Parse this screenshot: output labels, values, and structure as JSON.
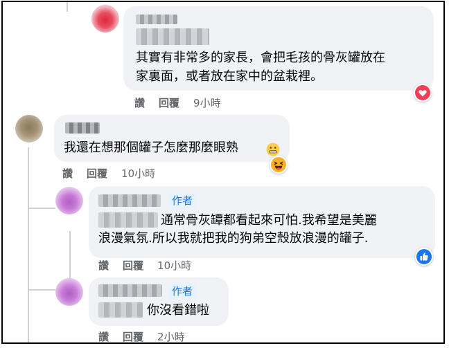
{
  "comments": [
    {
      "body_lines": [
        "其實有非常多的家長，會把毛孩的骨灰罐放在",
        "家裏面，或者放在家中的盆栽裡。"
      ],
      "actions": {
        "like": "讚",
        "reply": "回覆",
        "time": "9小時"
      },
      "reaction": "love-icon"
    },
    {
      "body_lines": [
        "我還在想那個罐子怎麼那麼眼熟"
      ],
      "emoji": "grimace-emoji",
      "actions": {
        "like": "讚",
        "reply": "回覆",
        "time": "10小時"
      },
      "reaction": "laugh-icon"
    },
    {
      "badge": "作者",
      "body_lines": [
        "通常骨灰罈都看起來可怕.我￼希望是美麗",
        "浪漫氣氛.所以我就把我的狗弟空殼放浪漫的罐子."
      ],
      "actions": {
        "like": "讚",
        "reply": "回覆",
        "time": "10小時"
      },
      "reaction": "like-icon"
    },
    {
      "badge": "作者",
      "body_lines": [
        "你沒看錯啦"
      ],
      "actions": {
        "like": "讚",
        "reply": "回覆",
        "time": "2小時"
      }
    }
  ],
  "colors": {
    "bubble": "#f0f2f5",
    "meta": "#65676b",
    "author_badge_bg": "#e7f3ff",
    "author_badge_text": "#1877f2",
    "love": "#f33e58",
    "like": "#1877f2",
    "haha": "#f7b125"
  }
}
